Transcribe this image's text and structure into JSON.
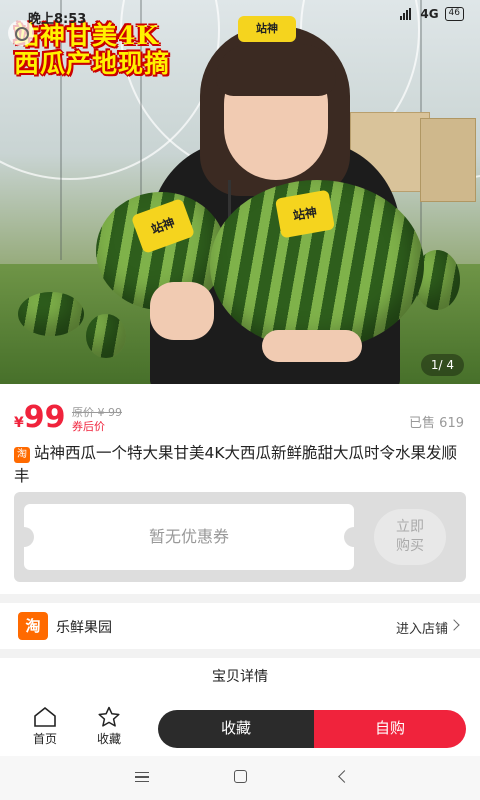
{
  "status_bar": {
    "time": "晚上8:53",
    "network": "4G",
    "battery": "46"
  },
  "hero": {
    "overlay_line1": "站神甘美4K",
    "overlay_line2": "西瓜产地现摘",
    "sticker_text": "站神",
    "pager": "1/ 4"
  },
  "product": {
    "currency": "¥",
    "price": "99",
    "original_price": "原价 ¥ 99",
    "after_coupon_label": "券后价",
    "sold": "已售 619",
    "title_badge": "淘",
    "title": "站神西瓜一个特大果甘美4K大西瓜新鲜脆甜大瓜时令水果发顺丰"
  },
  "coupon": {
    "text": "暂无优惠券",
    "button": "立即\n购买"
  },
  "shop": {
    "logo": "淘",
    "name": "乐鲜果园",
    "enter": "进入店铺"
  },
  "details": {
    "heading": "宝贝详情"
  },
  "action_bar": {
    "home_label": "首页",
    "favorite_label": "收藏",
    "collect_button": "收藏",
    "buy_button": "自购"
  },
  "colors": {
    "accent_red": "#f0233c",
    "dark_button": "#2b2b2b",
    "taobao_orange": "#ff6a00",
    "overlay_yellow": "#fff200"
  }
}
